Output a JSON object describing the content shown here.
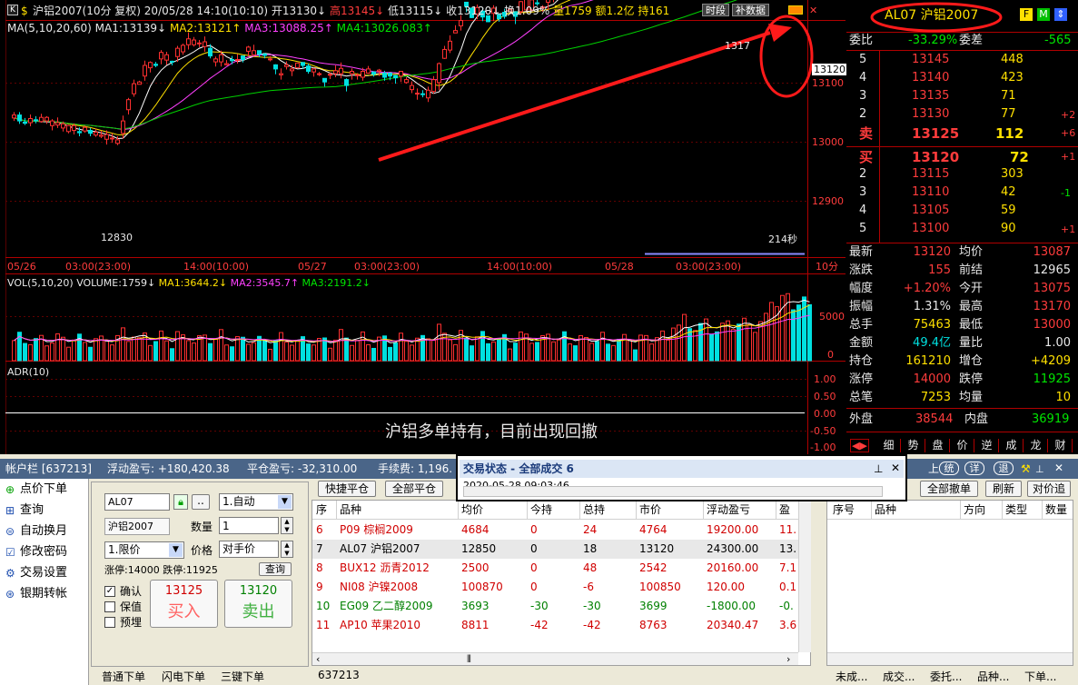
{
  "chart": {
    "header": {
      "code_box": "K",
      "sym": "$",
      "title": "沪铝2007(10分 复权) 20/05/28 14:10(10:10)",
      "open": "开13130↓",
      "high": "高13145↓",
      "low": "低13115↓",
      "close": "收13120↓",
      "turn": "换1.09%",
      "vol": "量1759",
      "amt": "额1.2亿",
      "hold": "持161",
      "btn_time": "时段",
      "btn_data": "补数据"
    },
    "ma": {
      "label": "MA(5,10,20,60)",
      "ma1": "MA1:13139↓",
      "ma2": "MA2:13121↑",
      "ma3": "MA3:13088.25↑",
      "ma4": "MA4:13026.083↑"
    },
    "price_ticks": [
      "13100",
      "13000",
      "12900"
    ],
    "last_label": "13120",
    "top_partial": "1317",
    "low_label": "12830",
    "sec_label": "214秒",
    "x_labels": [
      "05/26",
      "03:00(23:00)",
      "14:00(10:00)",
      "05/27",
      "03:00(23:00)",
      "14:00(10:00)",
      "05/28",
      "03:00(23:00)"
    ],
    "period": "10分",
    "vol": {
      "label": "VOL(5,10,20)",
      "volume": "VOLUME:1759↓",
      "ma1": "MA1:3644.2↓",
      "ma2": "MA2:3545.7↑",
      "ma3": "MA3:2191.2↓",
      "ticks": [
        "5000",
        "0"
      ]
    },
    "adr": {
      "label": "ADR(10)",
      "ticks": [
        "1.00",
        "0.50",
        "0.00",
        "-0.50",
        "-1.00"
      ]
    },
    "annotation": "沪铝多单持有，目前出现回撤",
    "bars": [
      [
        13046,
        13041,
        13051,
        13036,
        "u"
      ],
      [
        13046,
        13036,
        13051,
        13031,
        "d"
      ],
      [
        13034,
        13032,
        13041,
        13029,
        "d"
      ],
      [
        13040,
        13033,
        13047,
        13027,
        "u"
      ],
      [
        13038,
        13037,
        13044,
        13032,
        "d"
      ],
      [
        13042,
        13035,
        13048,
        13033,
        "u"
      ],
      [
        13042,
        13036,
        13044,
        13031,
        "u"
      ],
      [
        13036,
        13028,
        13039,
        13020,
        "u"
      ],
      [
        13033,
        13029,
        13042,
        13024,
        "u"
      ],
      [
        13031,
        13024,
        13035,
        13018,
        "u"
      ],
      [
        13028,
        13018,
        13029,
        13015,
        "u"
      ],
      [
        13028,
        13020,
        13032,
        13013,
        "u"
      ],
      [
        13016,
        13018,
        13025,
        13010,
        "d"
      ],
      [
        13025,
        13019,
        13028,
        13016,
        "u"
      ],
      [
        13015,
        13020,
        13024,
        13010,
        "d"
      ],
      [
        13017,
        13012,
        13023,
        13009,
        "u"
      ],
      [
        13012,
        13010,
        13019,
        13007,
        "u"
      ],
      [
        13013,
        13005,
        13020,
        12996,
        "u"
      ],
      [
        13007,
        13006,
        13015,
        12999,
        "u"
      ],
      [
        13004,
        12998,
        13010,
        12995,
        "u"
      ],
      [
        13036,
        13015,
        13045,
        13006,
        "u"
      ],
      [
        13072,
        13055,
        13075,
        13047,
        "u"
      ],
      [
        13099,
        13082,
        13106,
        13077,
        "u"
      ],
      [
        13102,
        13098,
        13104,
        13098,
        "u"
      ],
      [
        13130,
        13112,
        13138,
        13104,
        "u"
      ],
      [
        13135,
        13126,
        13137,
        13118,
        "u"
      ],
      [
        13130,
        13132,
        13136,
        13127,
        "d"
      ],
      [
        13152,
        13141,
        13156,
        13132,
        "u"
      ],
      [
        13148,
        13139,
        13153,
        13131,
        "u"
      ],
      [
        13137,
        13137,
        13138,
        13130,
        "d"
      ],
      [
        13159,
        13145,
        13163,
        13136,
        "u"
      ],
      [
        13164,
        13153,
        13167,
        13148,
        "u"
      ],
      [
        13175,
        13165,
        13186,
        13157,
        "u"
      ],
      [
        13173,
        13165,
        13178,
        13162,
        "u"
      ],
      [
        13168,
        13167,
        13173,
        13161,
        "u"
      ],
      [
        13170,
        13162,
        13179,
        13153,
        "u"
      ],
      [
        13146,
        13159,
        13166,
        13142,
        "d"
      ],
      [
        13141,
        13136,
        13145,
        13128,
        "u"
      ],
      [
        13148,
        13136,
        13155,
        13128,
        "u"
      ],
      [
        13133,
        13131,
        13139,
        13130,
        "u"
      ],
      [
        13138,
        13140,
        13146,
        13132,
        "d"
      ],
      [
        13140,
        13139,
        13149,
        13133,
        "u"
      ],
      [
        13140,
        13146,
        13146,
        13135,
        "d"
      ],
      [
        13161,
        13154,
        13163,
        13145,
        "u"
      ],
      [
        13155,
        13148,
        13165,
        13146,
        "u"
      ],
      [
        13149,
        13155,
        13155,
        13144,
        "d"
      ],
      [
        13147,
        13149,
        13151,
        13142,
        "d"
      ],
      [
        13141,
        13140,
        13146,
        13137,
        "u"
      ],
      [
        13124,
        13131,
        13132,
        13115,
        "d"
      ],
      [
        13116,
        13114,
        13125,
        13106,
        "u"
      ],
      [
        13131,
        13128,
        13137,
        13123,
        "u"
      ],
      [
        13124,
        13121,
        13131,
        13112,
        "u"
      ],
      [
        13134,
        13126,
        13134,
        13125,
        "u"
      ],
      [
        13130,
        13135,
        13135,
        13124,
        "d"
      ],
      [
        13120,
        13129,
        13133,
        13116,
        "d"
      ],
      [
        13124,
        13119,
        13126,
        13111,
        "u"
      ],
      [
        13116,
        13115,
        13119,
        13112,
        "u"
      ],
      [
        13102,
        13108,
        13108,
        13094,
        "d"
      ],
      [
        13115,
        13114,
        13118,
        13107,
        "u"
      ],
      [
        13121,
        13116,
        13130,
        13110,
        "u"
      ],
      [
        13125,
        13116,
        13135,
        13108,
        "u"
      ],
      [
        13096,
        13106,
        13108,
        13086,
        "d"
      ],
      [
        13120,
        13116,
        13125,
        13106,
        "u"
      ],
      [
        13114,
        13114,
        13117,
        13106,
        "u"
      ],
      [
        13120,
        13110,
        13126,
        13104,
        "u"
      ],
      [
        13124,
        13117,
        13129,
        13116,
        "u"
      ],
      [
        13115,
        13119,
        13119,
        13111,
        "d"
      ],
      [
        13122,
        13120,
        13124,
        13112,
        "u"
      ],
      [
        13110,
        13117,
        13121,
        13104,
        "d"
      ],
      [
        13112,
        13117,
        13117,
        13105,
        "d"
      ],
      [
        13109,
        13113,
        13114,
        13099,
        "d"
      ],
      [
        13120,
        13112,
        13120,
        13102,
        "u"
      ],
      [
        13106,
        13101,
        13110,
        13099,
        "u"
      ],
      [
        13096,
        13089,
        13103,
        13083,
        "u"
      ],
      [
        13083,
        13082,
        13091,
        13072,
        "u"
      ],
      [
        13081,
        13082,
        13088,
        13076,
        "d"
      ],
      [
        13088,
        13075,
        13094,
        13068,
        "u"
      ],
      [
        13106,
        13086,
        13112,
        13082,
        "u"
      ],
      [
        13133,
        13101,
        13135,
        13088,
        "u"
      ],
      [
        13157,
        13142,
        13163,
        13141,
        "u"
      ],
      [
        13171,
        13156,
        13181,
        13151,
        "u"
      ],
      [
        13189,
        13185,
        13198,
        13185,
        "u"
      ],
      [
        13206,
        13197,
        13215,
        13189,
        "u"
      ],
      [
        13230,
        13237,
        13237,
        13220,
        "d"
      ],
      [
        13211,
        13227,
        13228,
        13210,
        "d"
      ],
      [
        13228,
        13217,
        13233,
        13208,
        "u"
      ],
      [
        13212,
        13222,
        13227,
        13205,
        "d"
      ],
      [
        13204,
        13214,
        13214,
        13203,
        "d"
      ],
      [
        13227,
        13218,
        13232,
        13205,
        "u"
      ],
      [
        13209,
        13216,
        13216,
        13204,
        "d"
      ],
      [
        13213,
        13220,
        13226,
        13209,
        "d"
      ],
      [
        13225,
        13221,
        13225,
        13220,
        "u"
      ],
      [
        13213,
        13221,
        13219,
        13200,
        "d"
      ],
      [
        13238,
        13221,
        13239,
        13216,
        "u"
      ],
      [
        13245,
        13224,
        13247,
        13222,
        "u"
      ],
      [
        13241,
        13224,
        13246,
        13222,
        "u"
      ],
      [
        13236,
        13236,
        13244,
        13231,
        "d"
      ],
      [
        13229,
        13229,
        13232,
        13221,
        "u"
      ],
      [
        13249,
        13237,
        13257,
        13224,
        "u"
      ],
      [
        13260,
        13242,
        13265,
        13237,
        "u"
      ],
      [
        13273,
        13269,
        13278,
        13267,
        "u"
      ],
      [
        13257,
        13264,
        13270,
        13247,
        "d"
      ],
      [
        13270,
        13262,
        13278,
        13262,
        "u"
      ],
      [
        13267,
        13271,
        13275,
        13261,
        "d"
      ],
      [
        13276,
        13271,
        13283,
        13268,
        "u"
      ],
      [
        13280,
        13268,
        13280,
        13266,
        "u"
      ],
      [
        13282,
        13280,
        13292,
        13269,
        "u"
      ],
      [
        13265,
        13274,
        13278,
        13260,
        "d"
      ],
      [
        13277,
        13270,
        13283,
        13263,
        "u"
      ],
      [
        13272,
        13274,
        13277,
        13272,
        "d"
      ],
      [
        13280,
        13277,
        13291,
        13272,
        "u"
      ],
      [
        13274,
        13280,
        13289,
        13274,
        "d"
      ],
      [
        13281,
        13278,
        13286,
        13271,
        "u"
      ],
      [
        13293,
        13283,
        13301,
        13277,
        "u"
      ],
      [
        13281,
        13283,
        13282,
        13277,
        "d"
      ],
      [
        13283,
        13279,
        13288,
        13270,
        "u"
      ],
      [
        13279,
        13274,
        13284,
        13267,
        "u"
      ],
      [
        13297,
        13282,
        13302,
        13282,
        "u"
      ],
      [
        13307,
        13295,
        13319,
        13289,
        "u"
      ],
      [
        13300,
        13291,
        13309,
        13285,
        "u"
      ],
      [
        13291,
        13280,
        13292,
        13279,
        "u"
      ],
      [
        13302,
        13290,
        13307,
        13283,
        "u"
      ],
      [
        13296,
        13296,
        13297,
        13283,
        "u"
      ],
      [
        13302,
        13291,
        13307,
        13281,
        "u"
      ],
      [
        13302,
        13303,
        13306,
        13295,
        "d"
      ],
      [
        13308,
        13305,
        13317,
        13301,
        "u"
      ],
      [
        13302,
        13308,
        13311,
        13301,
        "d"
      ],
      [
        13306,
        13303,
        13312,
        13294,
        "u"
      ],
      [
        13293,
        13295,
        13294,
        13291,
        "d"
      ],
      [
        13284,
        13289,
        13289,
        13282,
        "d"
      ],
      [
        13279,
        13278,
        13283,
        13278,
        "u"
      ],
      [
        13289,
        13282,
        13295,
        13275,
        "u"
      ],
      [
        13285,
        13279,
        13295,
        13275,
        "u"
      ],
      [
        13287,
        13293,
        13297,
        13278,
        "d"
      ],
      [
        13293,
        13288,
        13297,
        13281,
        "u"
      ],
      [
        13296,
        13289,
        13304,
        13285,
        "u"
      ],
      [
        13300,
        13294,
        13304,
        13292,
        "u"
      ],
      [
        13299,
        13293,
        13305,
        13288,
        "u"
      ],
      [
        13321,
        13303,
        13325,
        13294,
        "u"
      ],
      [
        13328,
        13312,
        13334,
        13308,
        "u"
      ],
      [
        13325,
        13321,
        13333,
        13317,
        "u"
      ],
      [
        13358,
        13347,
        13360,
        13340,
        "u"
      ],
      [
        13370,
        13354,
        13374,
        13344,
        "u"
      ],
      [
        13369,
        13370,
        13374,
        13362,
        "d"
      ],
      [
        13365,
        13366,
        13368,
        13355,
        "d"
      ],
      [
        13357,
        13358,
        13366,
        13353,
        "d"
      ],
      [
        13345,
        13355,
        13355,
        13345,
        "d"
      ]
    ]
  },
  "quote": {
    "title": "AL07 沪铝2007",
    "icons": [
      "F",
      "M",
      "⇕"
    ],
    "weibi_label": "委比",
    "weibi_val": "-33.29%",
    "weicha_label": "委差",
    "weicha_val": "-565",
    "sell": [
      {
        "lvl": "5",
        "price": "13145",
        "vol": "448",
        "chg": ""
      },
      {
        "lvl": "4",
        "price": "13140",
        "vol": "423",
        "chg": ""
      },
      {
        "lvl": "3",
        "price": "13135",
        "vol": "71",
        "chg": ""
      },
      {
        "lvl": "2",
        "price": "13130",
        "vol": "77",
        "chg": "+2"
      },
      {
        "lvl": "卖",
        "price": "13125",
        "vol": "112",
        "chg": "+6"
      }
    ],
    "buy": [
      {
        "lvl": "买",
        "price": "13120",
        "vol": "72",
        "chg": "+1"
      },
      {
        "lvl": "2",
        "price": "13115",
        "vol": "303",
        "chg": ""
      },
      {
        "lvl": "3",
        "price": "13110",
        "vol": "42",
        "chg": "-1"
      },
      {
        "lvl": "4",
        "price": "13105",
        "vol": "59",
        "chg": ""
      },
      {
        "lvl": "5",
        "price": "13100",
        "vol": "90",
        "chg": "+1"
      }
    ],
    "stats": [
      {
        "l1": "最新",
        "v1": "13120",
        "c1": "red",
        "l2": "均价",
        "v2": "13087",
        "c2": "red"
      },
      {
        "l1": "涨跌",
        "v1": "155",
        "c1": "red",
        "l2": "前结",
        "v2": "12965",
        "c2": "w"
      },
      {
        "l1": "幅度",
        "v1": "+1.20%",
        "c1": "red",
        "l2": "今开",
        "v2": "13075",
        "c2": "red"
      },
      {
        "l1": "振幅",
        "v1": "1.31%",
        "c1": "w",
        "l2": "最高",
        "v2": "13170",
        "c2": "red"
      },
      {
        "l1": "总手",
        "v1": "75463",
        "c1": "yel",
        "l2": "最低",
        "v2": "13000",
        "c2": "red"
      },
      {
        "l1": "金额",
        "v1": "49.4亿",
        "c1": "cy",
        "l2": "量比",
        "v2": "1.00",
        "c2": "w"
      },
      {
        "l1": "持仓",
        "v1": "161210",
        "c1": "yel",
        "l2": "增仓",
        "v2": "+4209",
        "c2": "yel"
      },
      {
        "l1": "涨停",
        "v1": "14000",
        "c1": "red",
        "l2": "跌停",
        "v2": "11925",
        "c2": "grn"
      },
      {
        "l1": "总笔",
        "v1": "7253",
        "c1": "yel",
        "l2": "均量",
        "v2": "10",
        "c2": "yel"
      }
    ],
    "wai_label": "外盘",
    "wai_val": "38544",
    "nei_label": "内盘",
    "nei_val": "36919",
    "tabs": [
      "细",
      "势",
      "盘",
      "价",
      "逆",
      "成",
      "龙",
      "财"
    ]
  },
  "account": {
    "label": "帐户栏 [637213]",
    "float_pnl": "浮动盈亏: +180,420.38",
    "close_pnl": "平仓盈亏: -32,310.00",
    "fee": "手续费: 1,196.",
    "right_btns": [
      "统",
      "详",
      "退"
    ],
    "pin": "📌"
  },
  "side_menu": [
    "点价下单",
    "查询",
    "自动换月",
    "修改密码",
    "交易设置",
    "银期转帐"
  ],
  "order": {
    "code": "AL07",
    "name": "沪铝2007",
    "mode": "1.自动",
    "qty_label": "数量",
    "qty": "1",
    "price_type": "1.限价",
    "price_label": "价格",
    "price": "对手价",
    "limits": "涨停:14000 跌停:11925",
    "query_btn": "查询",
    "confirm": "确认",
    "keep": "保值",
    "pre": "预埋",
    "buy_price": "13125",
    "buy_label": "买入",
    "sell_price": "13120",
    "sell_label": "卖出",
    "tabs": [
      "普通下单",
      "闪电下单",
      "三键下单"
    ]
  },
  "positions": {
    "btn_quick": "快捷平仓",
    "btn_all": "全部平仓",
    "cols": [
      "序",
      "品种",
      "均价",
      "今持",
      "总持",
      "市价",
      "浮动盈亏",
      "盈"
    ],
    "rows": [
      {
        "n": "6",
        "name": "P09 棕榈2009",
        "avg": "4684",
        "today": "0",
        "total": "24",
        "mkt": "4764",
        "pnl": "19200.00",
        "x": "11.",
        "color": "#d00000"
      },
      {
        "n": "7",
        "name": "AL07 沪铝2007",
        "avg": "12850",
        "today": "0",
        "total": "18",
        "mkt": "13120",
        "pnl": "24300.00",
        "x": "13.",
        "color": "#000000"
      },
      {
        "n": "8",
        "name": "BUX12 沥青2012",
        "avg": "2500",
        "today": "0",
        "total": "48",
        "mkt": "2542",
        "pnl": "20160.00",
        "x": "7.1",
        "color": "#d00000"
      },
      {
        "n": "9",
        "name": "NI08 沪镍2008",
        "avg": "100870",
        "today": "0",
        "total": "-6",
        "mkt": "100850",
        "pnl": "120.00",
        "x": "0.1",
        "color": "#d00000"
      },
      {
        "n": "10",
        "name": "EG09 乙二醇2009",
        "avg": "3693",
        "today": "-30",
        "total": "-30",
        "mkt": "3699",
        "pnl": "-1800.00",
        "x": "-0.",
        "color": "#008000"
      },
      {
        "n": "11",
        "name": "AP10 苹果2010",
        "avg": "8811",
        "today": "-42",
        "total": "-42",
        "mkt": "8763",
        "pnl": "20340.47",
        "x": "3.6",
        "color": "#d00000"
      }
    ],
    "footer": "637213"
  },
  "popup": {
    "title": "交易状态 - 全部成交 6",
    "sub": "2020-05-28 09:03:46"
  },
  "orders": {
    "btn_all": "全部撤单",
    "btn_refresh": "刷新",
    "btn_chase": "对价追",
    "cols": [
      "序号",
      "品种",
      "方向",
      "类型",
      "数量"
    ],
    "tabs": [
      "未成...",
      "成交...",
      "委托...",
      "品种...",
      "下单..."
    ]
  }
}
